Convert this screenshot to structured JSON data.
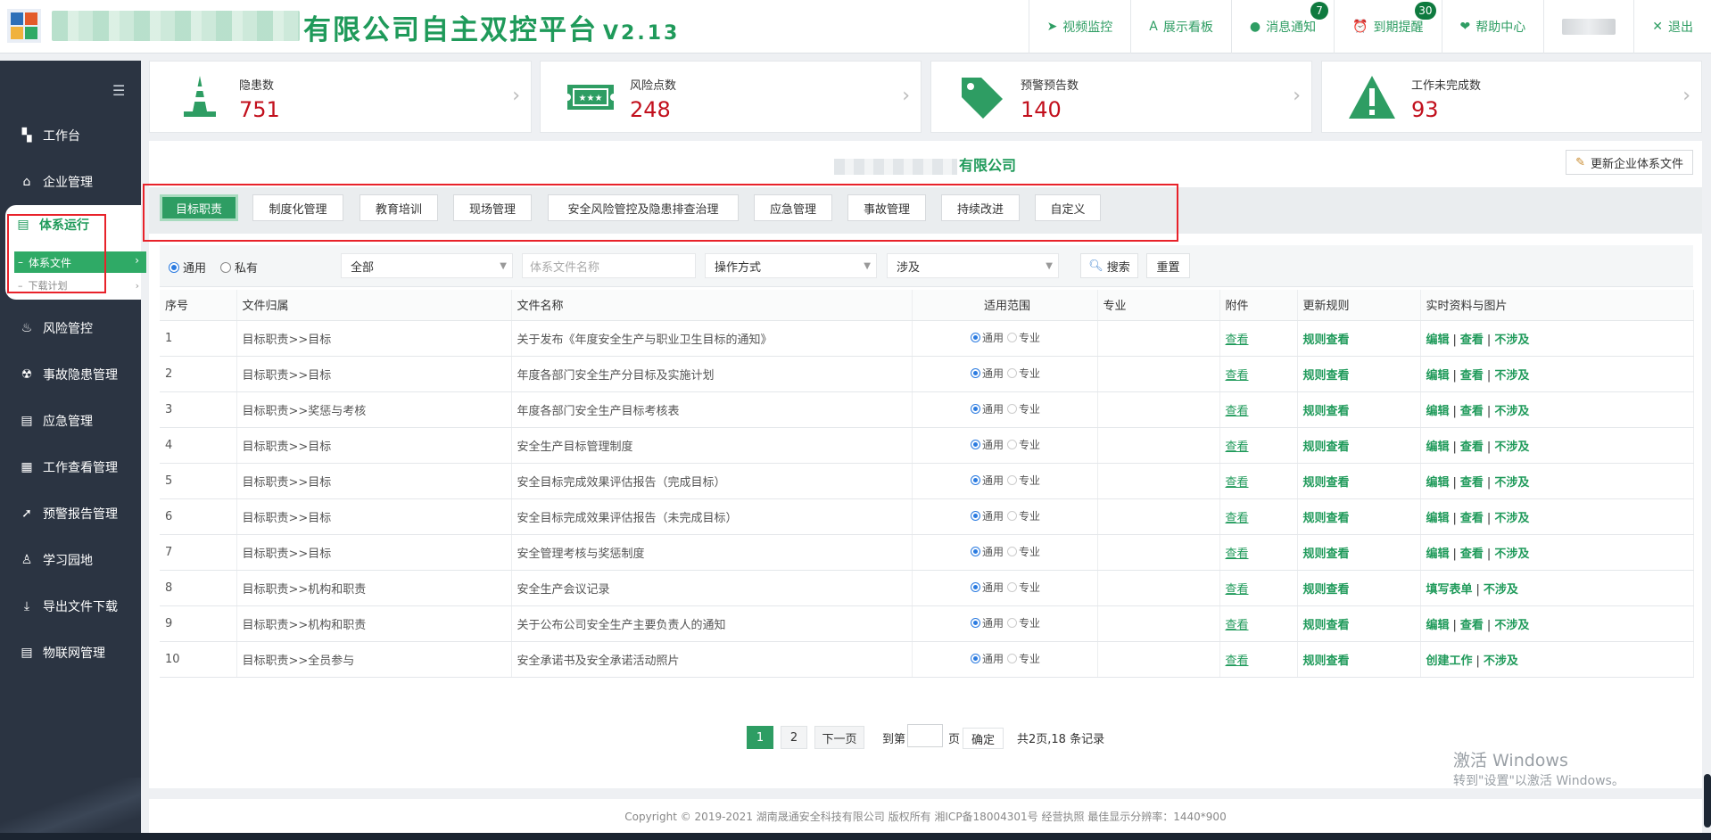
{
  "header": {
    "title": "有限公司自主双控平台",
    "version": "V2.13",
    "nav": [
      {
        "icon": "video-icon",
        "glyph": "➤",
        "label": "视频监控"
      },
      {
        "icon": "board-icon",
        "glyph": "A",
        "label": "展示看板"
      },
      {
        "icon": "message-icon",
        "glyph": "●",
        "label": "消息通知",
        "badge": "7"
      },
      {
        "icon": "alarm-clock-icon",
        "glyph": "⏰",
        "label": "到期提醒",
        "badge": "30"
      },
      {
        "icon": "heart-icon",
        "glyph": "❤",
        "label": "帮助中心"
      },
      {
        "icon": "close-icon",
        "glyph": "✕",
        "label": "退出"
      }
    ]
  },
  "sidebar": {
    "items": [
      {
        "icon": "dashboard-icon",
        "glyph": "▚",
        "label": "工作台"
      },
      {
        "icon": "home-icon",
        "glyph": "⌂",
        "label": "企业管理"
      },
      {
        "icon": "fire-icon",
        "glyph": "♨",
        "label": "风险管控"
      },
      {
        "icon": "radiation-icon",
        "glyph": "☢",
        "label": "事故隐患管理"
      },
      {
        "icon": "document-icon",
        "glyph": "▤",
        "label": "应急管理"
      },
      {
        "icon": "calendar-icon",
        "glyph": "▦",
        "label": "工作查看管理"
      },
      {
        "icon": "send-icon",
        "glyph": "➚",
        "label": "预警报告管理"
      },
      {
        "icon": "student-icon",
        "glyph": "♙",
        "label": "学习园地"
      },
      {
        "icon": "download-icon",
        "glyph": "⤓",
        "label": "导出文件下载"
      },
      {
        "icon": "file-icon",
        "glyph": "▤",
        "label": "物联网管理"
      }
    ],
    "active": {
      "label": "体系运行",
      "sub1": "体系文件",
      "sub2": "下载计划"
    }
  },
  "stats": [
    {
      "icon": "traffic-cone-icon",
      "label": "隐患数",
      "value": "751"
    },
    {
      "icon": "ticket-icon",
      "label": "风险点数",
      "value": "248"
    },
    {
      "icon": "tag-icon",
      "label": "预警预告数",
      "value": "140"
    },
    {
      "icon": "warning-icon",
      "label": "工作未完成数",
      "value": "93"
    }
  ],
  "company": {
    "name_suffix": "有限公司"
  },
  "update_button": "更新企业体系文件",
  "tabs": [
    "目标职责",
    "制度化管理",
    "教育培训",
    "现场管理",
    "安全风险管控及隐患排查治理",
    "应急管理",
    "事故管理",
    "持续改进",
    "自定义"
  ],
  "filter": {
    "radio_common": "通用",
    "radio_private": "私有",
    "scope_select": "全部",
    "name_placeholder": "体系文件名称",
    "op_select": "操作方式",
    "involve_select": "涉及",
    "search": "搜索",
    "reset": "重置"
  },
  "table": {
    "headers": [
      "序号",
      "文件归属",
      "文件名称",
      "适用范围",
      "专业",
      "附件",
      "更新规则",
      "实时资料与图片"
    ],
    "scope_common": "通用",
    "scope_pro": "专业",
    "view": "查看",
    "rule_view": "规则查看",
    "rows": [
      {
        "no": "1",
        "category": "目标职责>>目标",
        "name": "关于发布《年度安全生产与职业卫生目标的通知》",
        "actions": [
          "编辑",
          "查看",
          "不涉及"
        ]
      },
      {
        "no": "2",
        "category": "目标职责>>目标",
        "name": "年度各部门安全生产分目标及实施计划",
        "actions": [
          "编辑",
          "查看",
          "不涉及"
        ]
      },
      {
        "no": "3",
        "category": "目标职责>>奖惩与考核",
        "name": "年度各部门安全生产目标考核表",
        "actions": [
          "编辑",
          "查看",
          "不涉及"
        ]
      },
      {
        "no": "4",
        "category": "目标职责>>目标",
        "name": "安全生产目标管理制度",
        "actions": [
          "编辑",
          "查看",
          "不涉及"
        ]
      },
      {
        "no": "5",
        "category": "目标职责>>目标",
        "name": "安全目标完成效果评估报告（完成目标）",
        "actions": [
          "编辑",
          "查看",
          "不涉及"
        ]
      },
      {
        "no": "6",
        "category": "目标职责>>目标",
        "name": "安全目标完成效果评估报告（未完成目标）",
        "actions": [
          "编辑",
          "查看",
          "不涉及"
        ]
      },
      {
        "no": "7",
        "category": "目标职责>>目标",
        "name": "安全管理考核与奖惩制度",
        "actions": [
          "编辑",
          "查看",
          "不涉及"
        ]
      },
      {
        "no": "8",
        "category": "目标职责>>机构和职责",
        "name": "安全生产会议记录",
        "actions": [
          "填写表单",
          "不涉及"
        ]
      },
      {
        "no": "9",
        "category": "目标职责>>机构和职责",
        "name": "关于公布公司安全生产主要负责人的通知",
        "actions": [
          "编辑",
          "查看",
          "不涉及"
        ]
      },
      {
        "no": "10",
        "category": "目标职责>>全员参与",
        "name": "安全承诺书及安全承诺活动照片",
        "actions": [
          "创建工作",
          "不涉及"
        ]
      }
    ]
  },
  "pager": {
    "page1": "1",
    "page2": "2",
    "next": "下一页",
    "goto": "到第",
    "page_unit": "页",
    "confirm": "确定",
    "summary": "共2页,18 条记录"
  },
  "watermark": {
    "line1": "激活 Windows",
    "line2": "转到\"设置\"以激活 Windows。"
  },
  "footer": "Copyright © 2019-2021 湖南晟通安全科技有限公司 版权所有 湘ICP备18004301号 经营执照   最佳显示分辨率：1440*900"
}
